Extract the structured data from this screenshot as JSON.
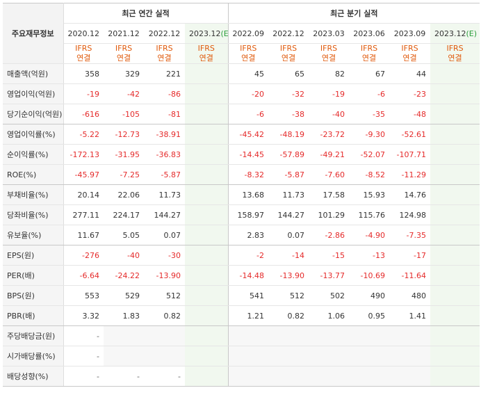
{
  "header": {
    "corner_label": "주요재무정보",
    "annual_title": "최근 연간 실적",
    "quarter_title": "최근 분기 실적"
  },
  "periods": {
    "annual": [
      "2020.12",
      "2021.12",
      "2022.12"
    ],
    "annual_est": {
      "base": "2023.12",
      "mark": "(E)"
    },
    "quarter": [
      "2022.09",
      "2022.12",
      "2023.03",
      "2023.06",
      "2023.09"
    ],
    "quarter_est": {
      "base": "2023.12",
      "mark": "(E)"
    }
  },
  "ifrs": {
    "line1": "IFRS",
    "line2": "연결"
  },
  "rows": [
    {
      "label": "매출액(억원)",
      "values": [
        "358",
        "329",
        "221",
        "",
        "45",
        "65",
        "82",
        "67",
        "44",
        ""
      ]
    },
    {
      "label": "영업이익(억원)",
      "values": [
        "-19",
        "-42",
        "-86",
        "",
        "-20",
        "-32",
        "-19",
        "-6",
        "-23",
        ""
      ]
    },
    {
      "label": "당기순이익(억원)",
      "values": [
        "-616",
        "-105",
        "-81",
        "",
        "-6",
        "-38",
        "-40",
        "-35",
        "-48",
        ""
      ]
    },
    {
      "label": "영업이익률(%)",
      "values": [
        "-5.22",
        "-12.73",
        "-38.91",
        "",
        "-45.42",
        "-48.19",
        "-23.72",
        "-9.30",
        "-52.61",
        ""
      ]
    },
    {
      "label": "순이익률(%)",
      "values": [
        "-172.13",
        "-31.95",
        "-36.83",
        "",
        "-14.45",
        "-57.89",
        "-49.21",
        "-52.07",
        "-107.71",
        ""
      ]
    },
    {
      "label": "ROE(%)",
      "values": [
        "-45.97",
        "-7.25",
        "-5.87",
        "",
        "-8.32",
        "-5.87",
        "-7.60",
        "-8.52",
        "-11.29",
        ""
      ]
    },
    {
      "label": "부채비율(%)",
      "values": [
        "20.14",
        "22.06",
        "11.73",
        "",
        "13.68",
        "11.73",
        "17.58",
        "15.93",
        "14.76",
        ""
      ]
    },
    {
      "label": "당좌비율(%)",
      "values": [
        "277.11",
        "224.17",
        "144.27",
        "",
        "158.97",
        "144.27",
        "101.29",
        "115.76",
        "124.98",
        ""
      ]
    },
    {
      "label": "유보율(%)",
      "values": [
        "11.67",
        "5.05",
        "0.07",
        "",
        "2.83",
        "0.07",
        "-2.86",
        "-4.90",
        "-7.35",
        ""
      ]
    },
    {
      "label": "EPS(원)",
      "values": [
        "-276",
        "-40",
        "-30",
        "",
        "-2",
        "-14",
        "-15",
        "-13",
        "-17",
        ""
      ]
    },
    {
      "label": "PER(배)",
      "values": [
        "-6.64",
        "-24.22",
        "-13.90",
        "",
        "-14.48",
        "-13.90",
        "-13.77",
        "-10.69",
        "-11.64",
        ""
      ]
    },
    {
      "label": "BPS(원)",
      "values": [
        "553",
        "529",
        "512",
        "",
        "541",
        "512",
        "502",
        "490",
        "480",
        ""
      ]
    },
    {
      "label": "PBR(배)",
      "values": [
        "3.32",
        "1.83",
        "0.82",
        "",
        "1.21",
        "0.82",
        "1.06",
        "0.95",
        "1.41",
        ""
      ]
    },
    {
      "label": "주당배당금(원)",
      "values": [
        "-",
        "",
        "",
        "",
        "",
        "",
        "",
        "",
        "",
        ""
      ]
    },
    {
      "label": "시가배당률(%)",
      "values": [
        "-",
        "",
        "",
        "",
        "",
        "",
        "",
        "",
        "",
        ""
      ]
    },
    {
      "label": "배당성향(%)",
      "values": [
        "-",
        "-",
        "-",
        "",
        "",
        "",
        "",
        "",
        "",
        ""
      ]
    }
  ],
  "colors": {
    "negative": "#e52a2a",
    "ifrs": "#e05a0c",
    "estimate_mark": "#2a9d3a"
  }
}
